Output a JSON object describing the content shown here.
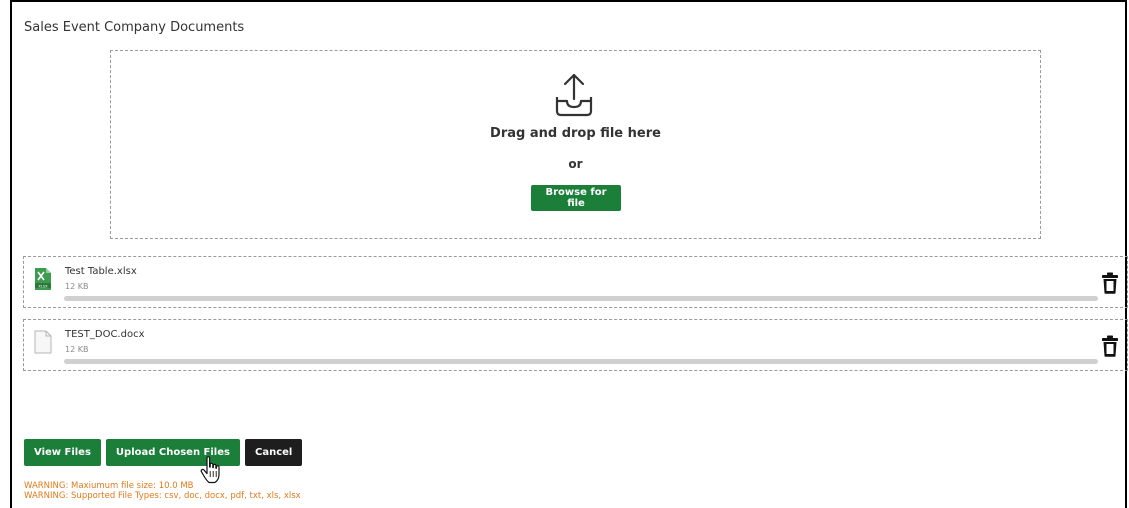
{
  "panel": {
    "title": "Sales Event Company Documents"
  },
  "dropzone": {
    "icon": "upload-tray-icon",
    "drag_text": "Drag and drop file here",
    "or_text": "or",
    "browse_label": "Browse for file"
  },
  "files": [
    {
      "name": "Test Table.xlsx",
      "size": "12 KB",
      "icon": "xlsx-file-icon",
      "progress": 100
    },
    {
      "name": "TEST_DOC.docx",
      "size": "12 KB",
      "icon": "document-file-icon",
      "progress": 100
    }
  ],
  "actions": {
    "view_label": "View Files",
    "upload_label": "Upload Chosen Files",
    "cancel_label": "Cancel"
  },
  "warnings": {
    "max_size": "WARNING: Maxiumum file size: 10.0 MB",
    "types": "WARNING: Supported File Types: csv, doc, docx, pdf, txt, xls, xlsx"
  },
  "colors": {
    "primary": "#1b7f3a",
    "dark_button": "#1e1e1e",
    "warning": "#e07b1a",
    "progress_track": "#d0d0d0"
  }
}
